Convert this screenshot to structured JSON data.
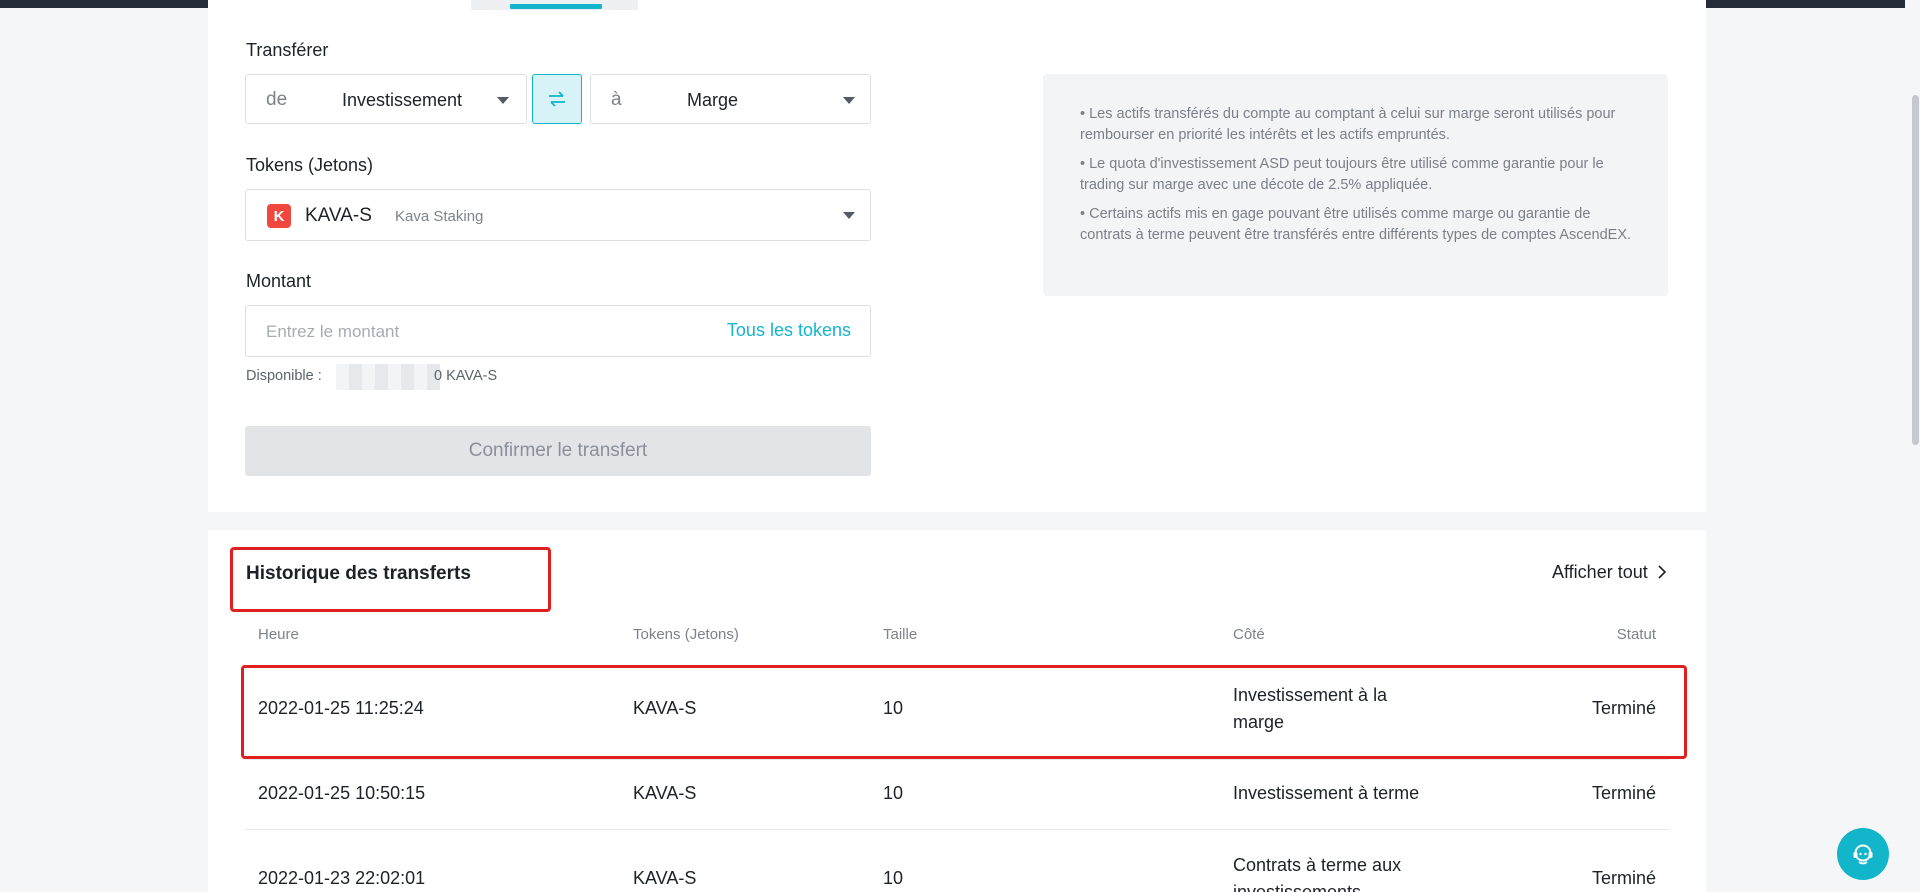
{
  "transfer": {
    "label": "Transférer",
    "from_prefix": "de",
    "from_value": "Investissement",
    "to_prefix": "à",
    "to_value": "Marge"
  },
  "tokens": {
    "label": "Tokens (Jetons)",
    "symbol": "KAVA-S",
    "name": "Kava Staking",
    "icon_letter": "K",
    "icon_color": "#f0483e"
  },
  "amount": {
    "label": "Montant",
    "placeholder": "Entrez le montant",
    "all_tokens": "Tous les tokens",
    "available_label": "Disponible :",
    "available_suffix": "0 KAVA-S"
  },
  "confirm_button": "Confirmer le transfert",
  "info": [
    "• Les actifs transférés du compte au comptant à celui sur marge seront utilisés pour rembourser en priorité les intérêts et les actifs empruntés.",
    "• Le quota d'investissement ASD peut toujours être utilisé comme garantie pour le trading sur marge avec une décote de 2.5% appliquée.",
    "• Certains actifs mis en gage pouvant être utilisés comme marge ou garantie de contrats à terme peuvent être transférés entre différents types de comptes AscendEX."
  ],
  "history": {
    "title": "Historique des transferts",
    "view_all": "Afficher tout",
    "columns": [
      "Heure",
      "Tokens (Jetons)",
      "Taille",
      "Côté",
      "Statut"
    ],
    "rows": [
      {
        "time": "2022-01-25 11:25:24",
        "token": "KAVA-S",
        "size": "10",
        "side": "Investissement à la marge",
        "status": "Terminé"
      },
      {
        "time": "2022-01-25 10:50:15",
        "token": "KAVA-S",
        "size": "10",
        "side": "Investissement à terme",
        "status": "Terminé"
      },
      {
        "time": "2022-01-23 22:02:01",
        "token": "KAVA-S",
        "size": "10",
        "side": "Contrats à terme aux investissements",
        "status": "Terminé"
      }
    ]
  },
  "colors": {
    "accent": "#13b5cb",
    "highlight": "#e02020",
    "text": "#1d2129"
  }
}
